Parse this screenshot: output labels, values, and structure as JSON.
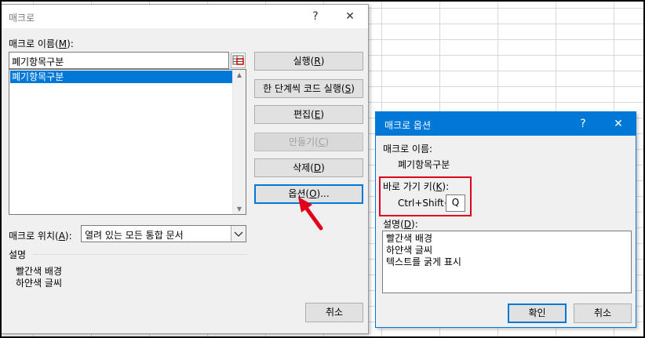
{
  "main_dialog": {
    "title": "매크로",
    "help_glyph": "?",
    "close_glyph": "✕",
    "name_label": "매크로 이름(",
    "name_label_key": "M",
    "name_label_end": "):",
    "name_value": "폐기항목구분",
    "list_items": [
      "폐기항목구분"
    ],
    "buttons": {
      "run": {
        "text": "실행(",
        "key": "R",
        "end": ")"
      },
      "step": {
        "text": "한 단계씩 코드 실행(",
        "key": "S",
        "end": ")"
      },
      "edit": {
        "text": "편집(",
        "key": "E",
        "end": ")"
      },
      "create": {
        "text": "만들기(",
        "key": "C",
        "end": ")"
      },
      "delete": {
        "text": "삭제(",
        "key": "D",
        "end": ")"
      },
      "options": {
        "text": "옵션(",
        "key": "O",
        "end": ")..."
      },
      "cancel": "취소"
    },
    "location_label": "매크로 위치(",
    "location_key": "A",
    "location_end": "):",
    "location_value": "열려 있는 모든 통합 문서",
    "description_label": "설명",
    "description_lines": [
      "빨간색 배경",
      "하얀색 글씨"
    ]
  },
  "options_dialog": {
    "title": "매크로 옵션",
    "help_glyph": "?",
    "close_glyph": "✕",
    "macro_name_label": "매크로 이름:",
    "macro_name_value": "폐기항목구분",
    "shortcut_label": "바로 가기 키(",
    "shortcut_key": "K",
    "shortcut_end": "):",
    "shortcut_prefix": "Ctrl+Shift+",
    "shortcut_value": "Q",
    "description_label": "설명(",
    "description_key": "D",
    "description_end": "):",
    "description_lines": [
      "빨간색 배경",
      "하얀색 글씨",
      "텍스트를 굵게 표시"
    ],
    "ok_button": "확인",
    "cancel_button": "취소"
  },
  "colors": {
    "accent": "#0078d7",
    "annotation_red": "#e0001b"
  }
}
